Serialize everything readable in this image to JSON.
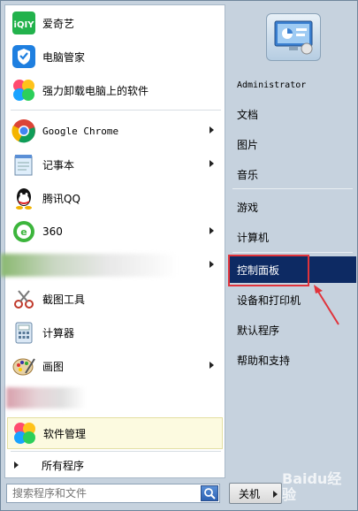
{
  "left_menu": {
    "pinned": [
      {
        "label": "爱奇艺",
        "icon": "iqiyi-icon"
      },
      {
        "label": "电脑管家",
        "icon": "pc-manager-icon"
      },
      {
        "label": "强力卸载电脑上的软件",
        "icon": "uninstall-icon"
      }
    ],
    "recent": [
      {
        "label": "Google Chrome",
        "icon": "chrome-icon",
        "submenu": true
      },
      {
        "label": "记事本",
        "icon": "notepad-icon",
        "submenu": true
      },
      {
        "label": "腾讯QQ",
        "icon": "qq-icon",
        "submenu": false
      },
      {
        "label": "360",
        "icon": "360-browser-icon",
        "submenu": true
      },
      {
        "label": "",
        "icon": "blurred-app-icon",
        "submenu": true
      },
      {
        "label": "截图工具",
        "icon": "snipping-tool-icon",
        "submenu": false
      },
      {
        "label": "计算器",
        "icon": "calculator-icon",
        "submenu": false
      },
      {
        "label": "画图",
        "icon": "paint-icon",
        "submenu": true
      },
      {
        "label": "",
        "icon": "blurred-app-icon",
        "submenu": false
      },
      {
        "label": "软件管理",
        "icon": "software-manager-icon",
        "submenu": false
      }
    ],
    "all_programs": "所有程序"
  },
  "search": {
    "placeholder": "搜索程序和文件",
    "icon": "search-icon"
  },
  "right_menu": {
    "user": "Administrator",
    "items": [
      {
        "label": "文档"
      },
      {
        "label": "图片"
      },
      {
        "label": "音乐"
      },
      {
        "label": "游戏"
      },
      {
        "label": "计算机"
      },
      {
        "label": "控制面板",
        "selected": true
      },
      {
        "label": "设备和打印机"
      },
      {
        "label": "默认程序"
      },
      {
        "label": "帮助和支持"
      }
    ]
  },
  "shutdown": {
    "label": "关机"
  },
  "watermark": "Baidu经验",
  "colors": {
    "selected_bg": "#0d2a63",
    "highlight_box": "#e0333b",
    "new_item_bg": "#fcfae0"
  }
}
